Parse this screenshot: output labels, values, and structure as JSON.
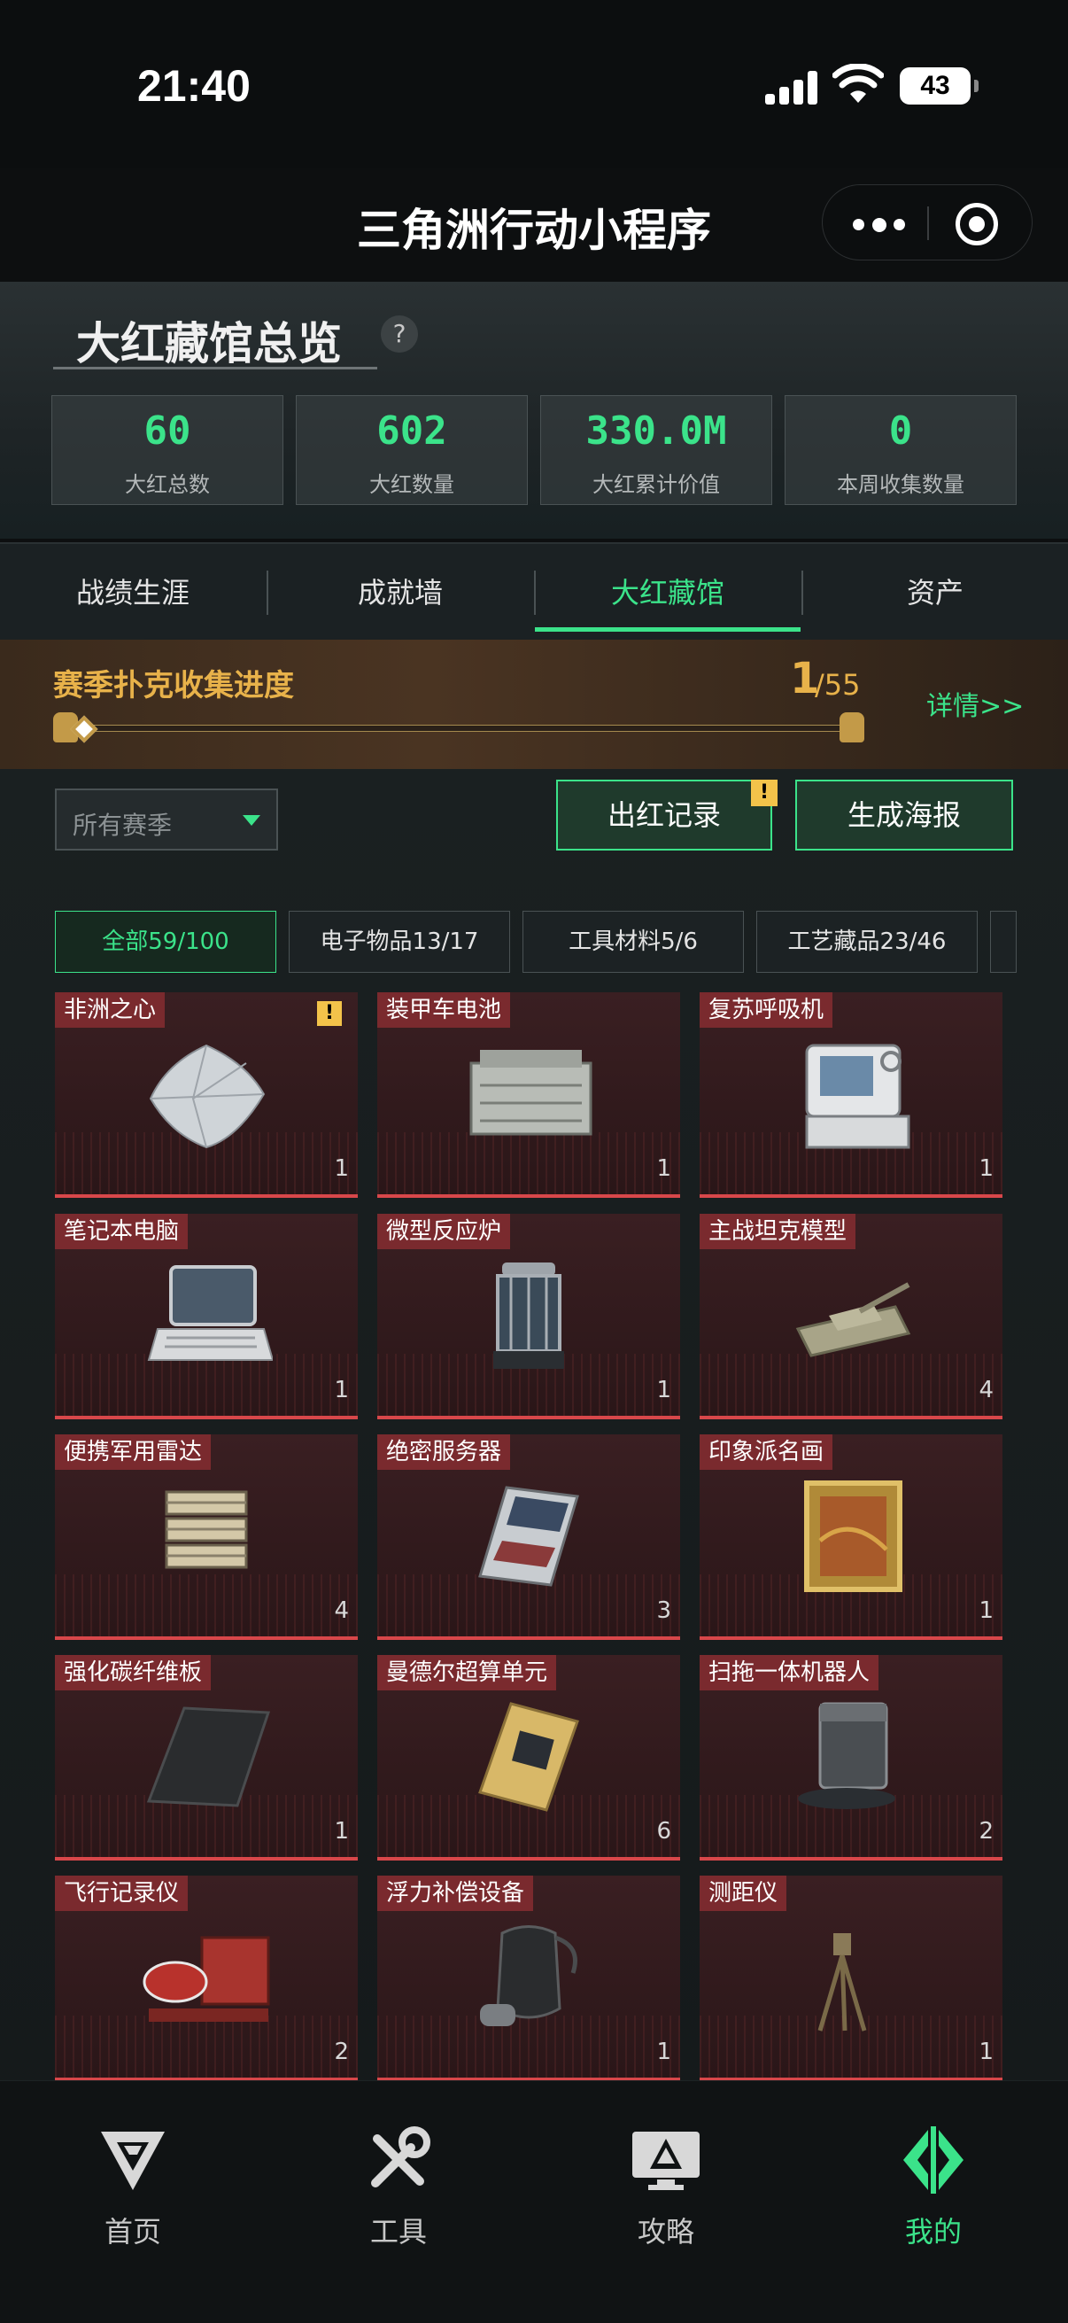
{
  "status_bar": {
    "time": "21:40",
    "battery": "43"
  },
  "nav": {
    "title": "三角洲行动小程序"
  },
  "overview": {
    "title": "大红藏馆总览",
    "help": "?",
    "stats": [
      {
        "value": "60",
        "label": "大红总数"
      },
      {
        "value": "602",
        "label": "大红数量"
      },
      {
        "value": "330.0M",
        "label": "大红累计价值"
      },
      {
        "value": "0",
        "label": "本周收集数量"
      }
    ]
  },
  "tabs": [
    {
      "label": "战绩生涯"
    },
    {
      "label": "成就墙"
    },
    {
      "label": "大红藏馆"
    },
    {
      "label": "资产"
    }
  ],
  "season": {
    "title": "赛季扑克收集进度",
    "current": "1",
    "total": "/55",
    "progress": 0.018,
    "details": "详情>>"
  },
  "filters": {
    "season_select": "所有赛季",
    "record_button": "出红记录",
    "record_alert": "!",
    "poster_button": "生成海报"
  },
  "categories": [
    {
      "label": "全部59/100"
    },
    {
      "label": "电子物品13/17"
    },
    {
      "label": "工具材料5/6"
    },
    {
      "label": "工艺藏品23/46"
    }
  ],
  "items": [
    {
      "name": "非洲之心",
      "count": "1",
      "alert": "!"
    },
    {
      "name": "装甲车电池",
      "count": "1"
    },
    {
      "name": "复苏呼吸机",
      "count": "1"
    },
    {
      "name": "笔记本电脑",
      "count": "1"
    },
    {
      "name": "微型反应炉",
      "count": "1"
    },
    {
      "name": "主战坦克模型",
      "count": "4"
    },
    {
      "name": "便携军用雷达",
      "count": "4"
    },
    {
      "name": "绝密服务器",
      "count": "3"
    },
    {
      "name": "印象派名画",
      "count": "1"
    },
    {
      "name": "强化碳纤维板",
      "count": "1"
    },
    {
      "name": "曼德尔超算单元",
      "count": "6"
    },
    {
      "name": "扫拖一体机器人",
      "count": "2"
    },
    {
      "name": "飞行记录仪",
      "count": "2"
    },
    {
      "name": "浮力补偿设备",
      "count": "1"
    },
    {
      "name": "测距仪",
      "count": "1"
    }
  ],
  "bottom_nav": [
    {
      "label": "首页",
      "icon": "delta-logo-icon"
    },
    {
      "label": "工具",
      "icon": "tools-icon"
    },
    {
      "label": "攻略",
      "icon": "monitor-icon"
    },
    {
      "label": "我的",
      "icon": "profile-logo-icon"
    }
  ],
  "colors": {
    "accent": "#3be38a",
    "gold": "#e8b24a",
    "red": "#d8474a"
  }
}
